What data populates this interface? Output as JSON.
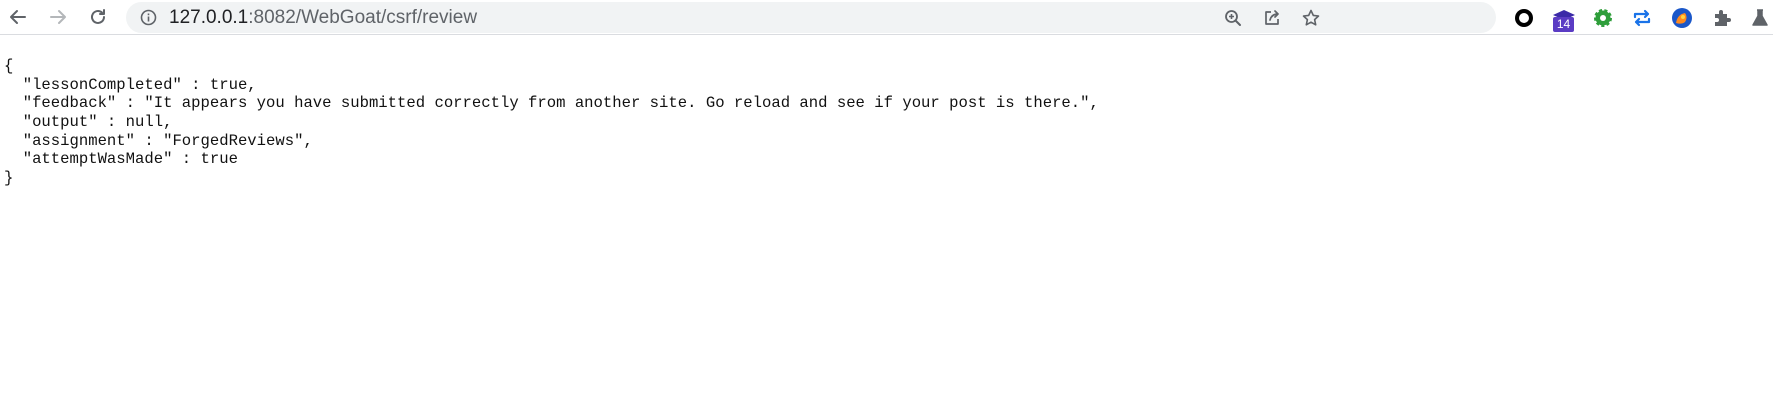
{
  "browser": {
    "url_host": "127.0.0.1",
    "url_rest": ":8082/WebGoat/csrf/review",
    "extension_badge": "14",
    "icons": {
      "back": "arrow-left-icon",
      "forward": "arrow-right-icon",
      "reload": "reload-icon",
      "info": "info-icon",
      "zoom": "zoom-icon",
      "share": "share-icon",
      "bookmark": "star-icon",
      "extensions": [
        "circle-extension-icon",
        "graduation-cap-extension-icon",
        "gear-extension-icon",
        "repeat-extension-icon",
        "fox-extension-icon",
        "puzzle-icon",
        "flask-icon"
      ]
    },
    "colors": {
      "badge": "#5b3cc4",
      "omnibox": "#f1f3f4"
    }
  },
  "json": {
    "lines": [
      "{",
      "  \"lessonCompleted\" : true,",
      "  \"feedback\" : \"It appears you have submitted correctly from another site. Go reload and see if your post is there.\",",
      "  \"output\" : null,",
      "  \"assignment\" : \"ForgedReviews\",",
      "  \"attemptWasMade\" : true",
      "}"
    ]
  }
}
